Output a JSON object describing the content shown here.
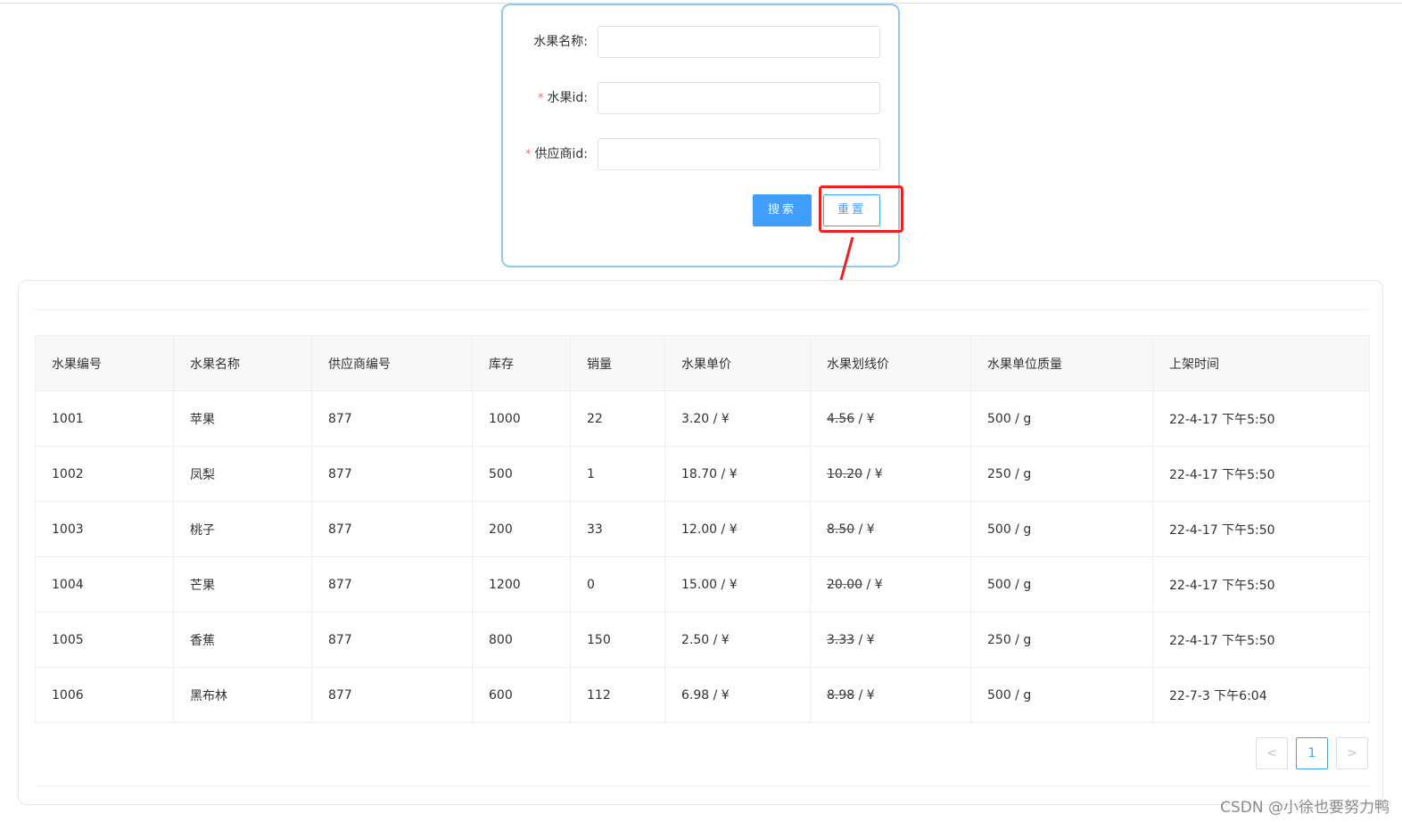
{
  "search_form": {
    "fields": [
      {
        "label": "水果名称:",
        "required": false,
        "value": ""
      },
      {
        "label": "水果id:",
        "required": true,
        "value": ""
      },
      {
        "label": "供应商id:",
        "required": true,
        "value": ""
      }
    ],
    "required_mark": "*",
    "search_button": "搜索",
    "reset_button": "重置"
  },
  "table": {
    "columns": [
      "水果编号",
      "水果名称",
      "供应商编号",
      "库存",
      "销量",
      "水果单价",
      "水果划线价",
      "水果单位质量",
      "上架时间"
    ],
    "rows": [
      {
        "id": "1001",
        "name": "苹果",
        "supplier": "877",
        "stock": "1000",
        "sales": "22",
        "price": "3.20",
        "price_unit": " / ¥",
        "orig_price": "4.56",
        "orig_unit": " / ¥",
        "weight": "500 / g",
        "listed": "22-4-17 下午5:50"
      },
      {
        "id": "1002",
        "name": "凤梨",
        "supplier": "877",
        "stock": "500",
        "sales": "1",
        "price": "18.70",
        "price_unit": " / ¥",
        "orig_price": "10.20",
        "orig_unit": " / ¥",
        "weight": "250 / g",
        "listed": "22-4-17 下午5:50"
      },
      {
        "id": "1003",
        "name": "桃子",
        "supplier": "877",
        "stock": "200",
        "sales": "33",
        "price": "12.00",
        "price_unit": " / ¥",
        "orig_price": "8.50",
        "orig_unit": " / ¥",
        "weight": "500 / g",
        "listed": "22-4-17 下午5:50"
      },
      {
        "id": "1004",
        "name": "芒果",
        "supplier": "877",
        "stock": "1200",
        "sales": "0",
        "price": "15.00",
        "price_unit": " / ¥",
        "orig_price": "20.00",
        "orig_unit": " / ¥",
        "weight": "500 / g",
        "listed": "22-4-17 下午5:50"
      },
      {
        "id": "1005",
        "name": "香蕉",
        "supplier": "877",
        "stock": "800",
        "sales": "150",
        "price": "2.50",
        "price_unit": " / ¥",
        "orig_price": "3.33",
        "orig_unit": " / ¥",
        "weight": "250 / g",
        "listed": "22-4-17 下午5:50"
      },
      {
        "id": "1006",
        "name": "黑布林",
        "supplier": "877",
        "stock": "600",
        "sales": "112",
        "price": "6.98",
        "price_unit": " / ¥",
        "orig_price": "8.98",
        "orig_unit": " / ¥",
        "weight": "500 / g",
        "listed": "22-7-3 下午6:04"
      }
    ]
  },
  "pagination": {
    "prev": "<",
    "current": "1",
    "next": ">"
  },
  "watermark": "CSDN @小徐也要努力鸭",
  "colors": {
    "primary": "#409eff",
    "annotation": "#ee1f1f",
    "form_border": "#8ec9ee",
    "strike": "#e33"
  }
}
